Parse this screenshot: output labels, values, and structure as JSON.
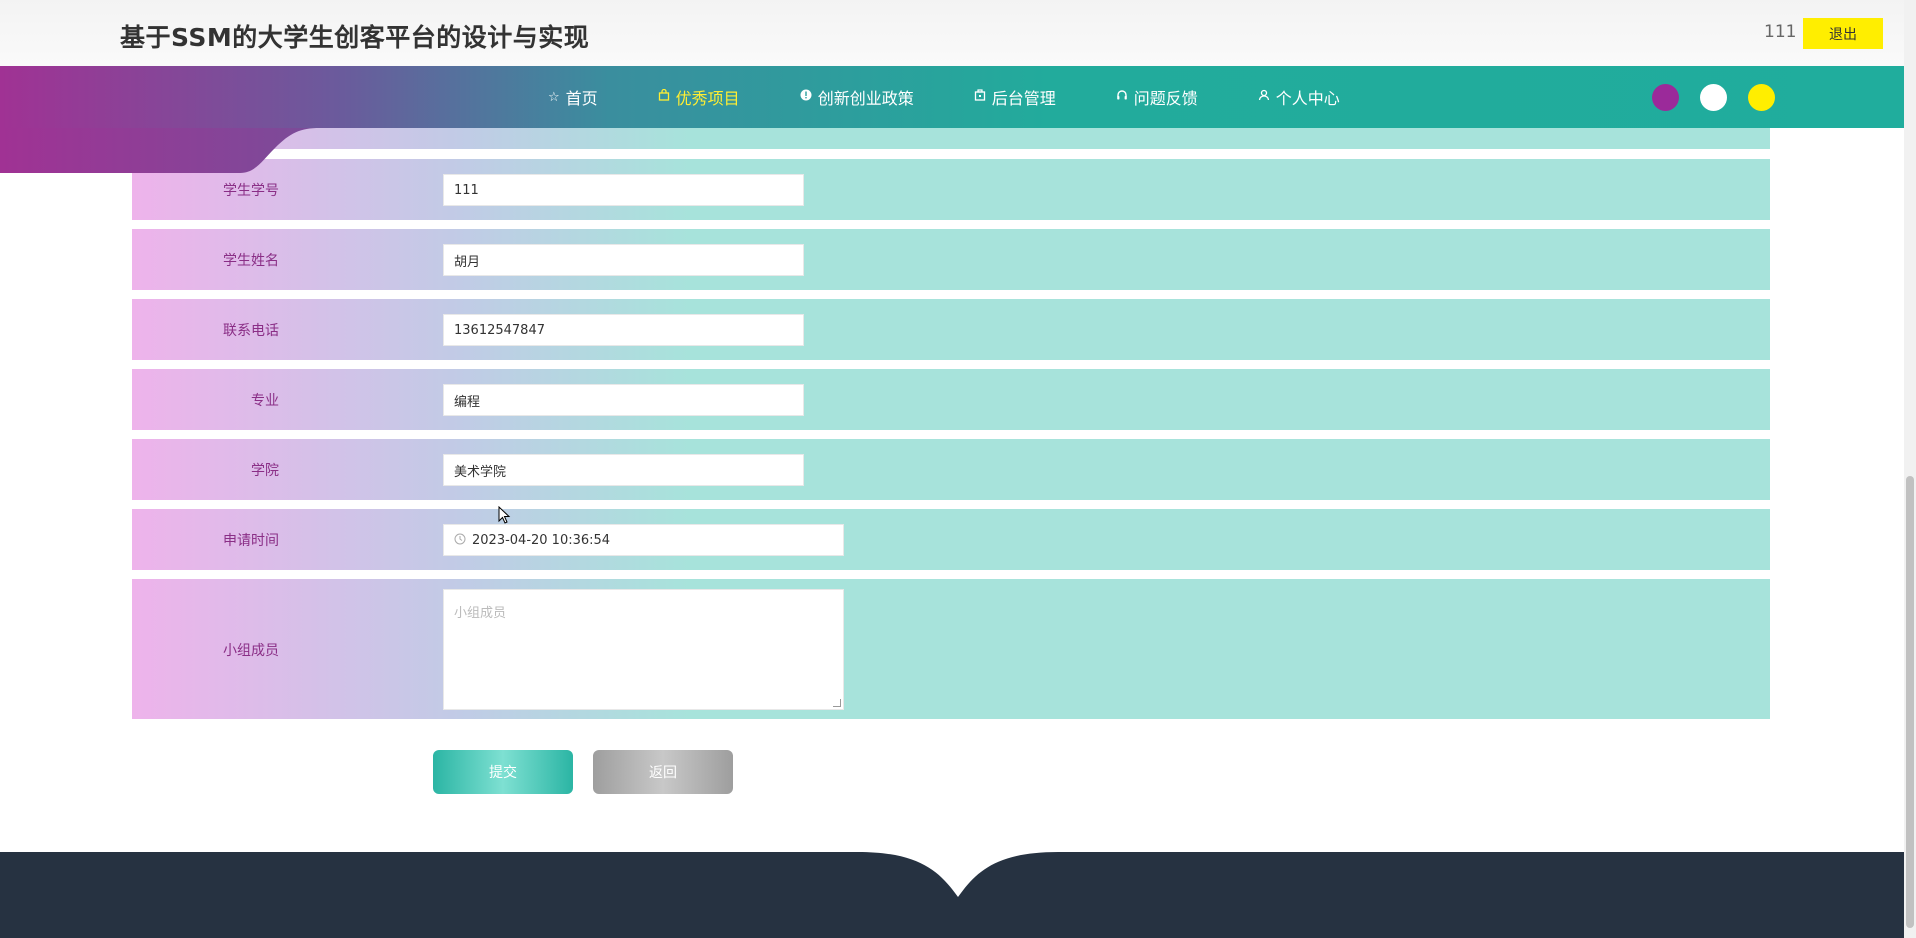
{
  "header": {
    "title": "基于SSM的大学生创客平台的设计与实现",
    "username": "111",
    "logout_label": "退出"
  },
  "nav": {
    "items": [
      {
        "icon": "star-icon",
        "label": "首页",
        "active": false
      },
      {
        "icon": "bag-icon",
        "label": "优秀项目",
        "active": true
      },
      {
        "icon": "info-icon",
        "label": "创新创业政策",
        "active": false
      },
      {
        "icon": "building-icon",
        "label": "后台管理",
        "active": false
      },
      {
        "icon": "headset-icon",
        "label": "问题反馈",
        "active": false
      },
      {
        "icon": "user-icon",
        "label": "个人中心",
        "active": false
      }
    ],
    "theme_colors": [
      "#9b2a9a",
      "#ffffff",
      "#ffee00"
    ]
  },
  "form": {
    "fields": [
      {
        "label": "学生学号",
        "value": "111"
      },
      {
        "label": "学生姓名",
        "value": "胡月"
      },
      {
        "label": "联系电话",
        "value": "13612547847"
      },
      {
        "label": "专业",
        "value": "编程"
      },
      {
        "label": "学院",
        "value": "美术学院"
      }
    ],
    "apply_time": {
      "label": "申请时间",
      "value": "2023-04-20 10:36:54"
    },
    "members": {
      "label": "小组成员",
      "placeholder": "小组成员"
    },
    "submit_label": "提交",
    "back_label": "返回"
  },
  "colors": {
    "accent": "#20ad9d",
    "brand_purple": "#a03294",
    "highlight": "#ffee00",
    "label_text": "#8a2e86",
    "footer": "#263241"
  }
}
